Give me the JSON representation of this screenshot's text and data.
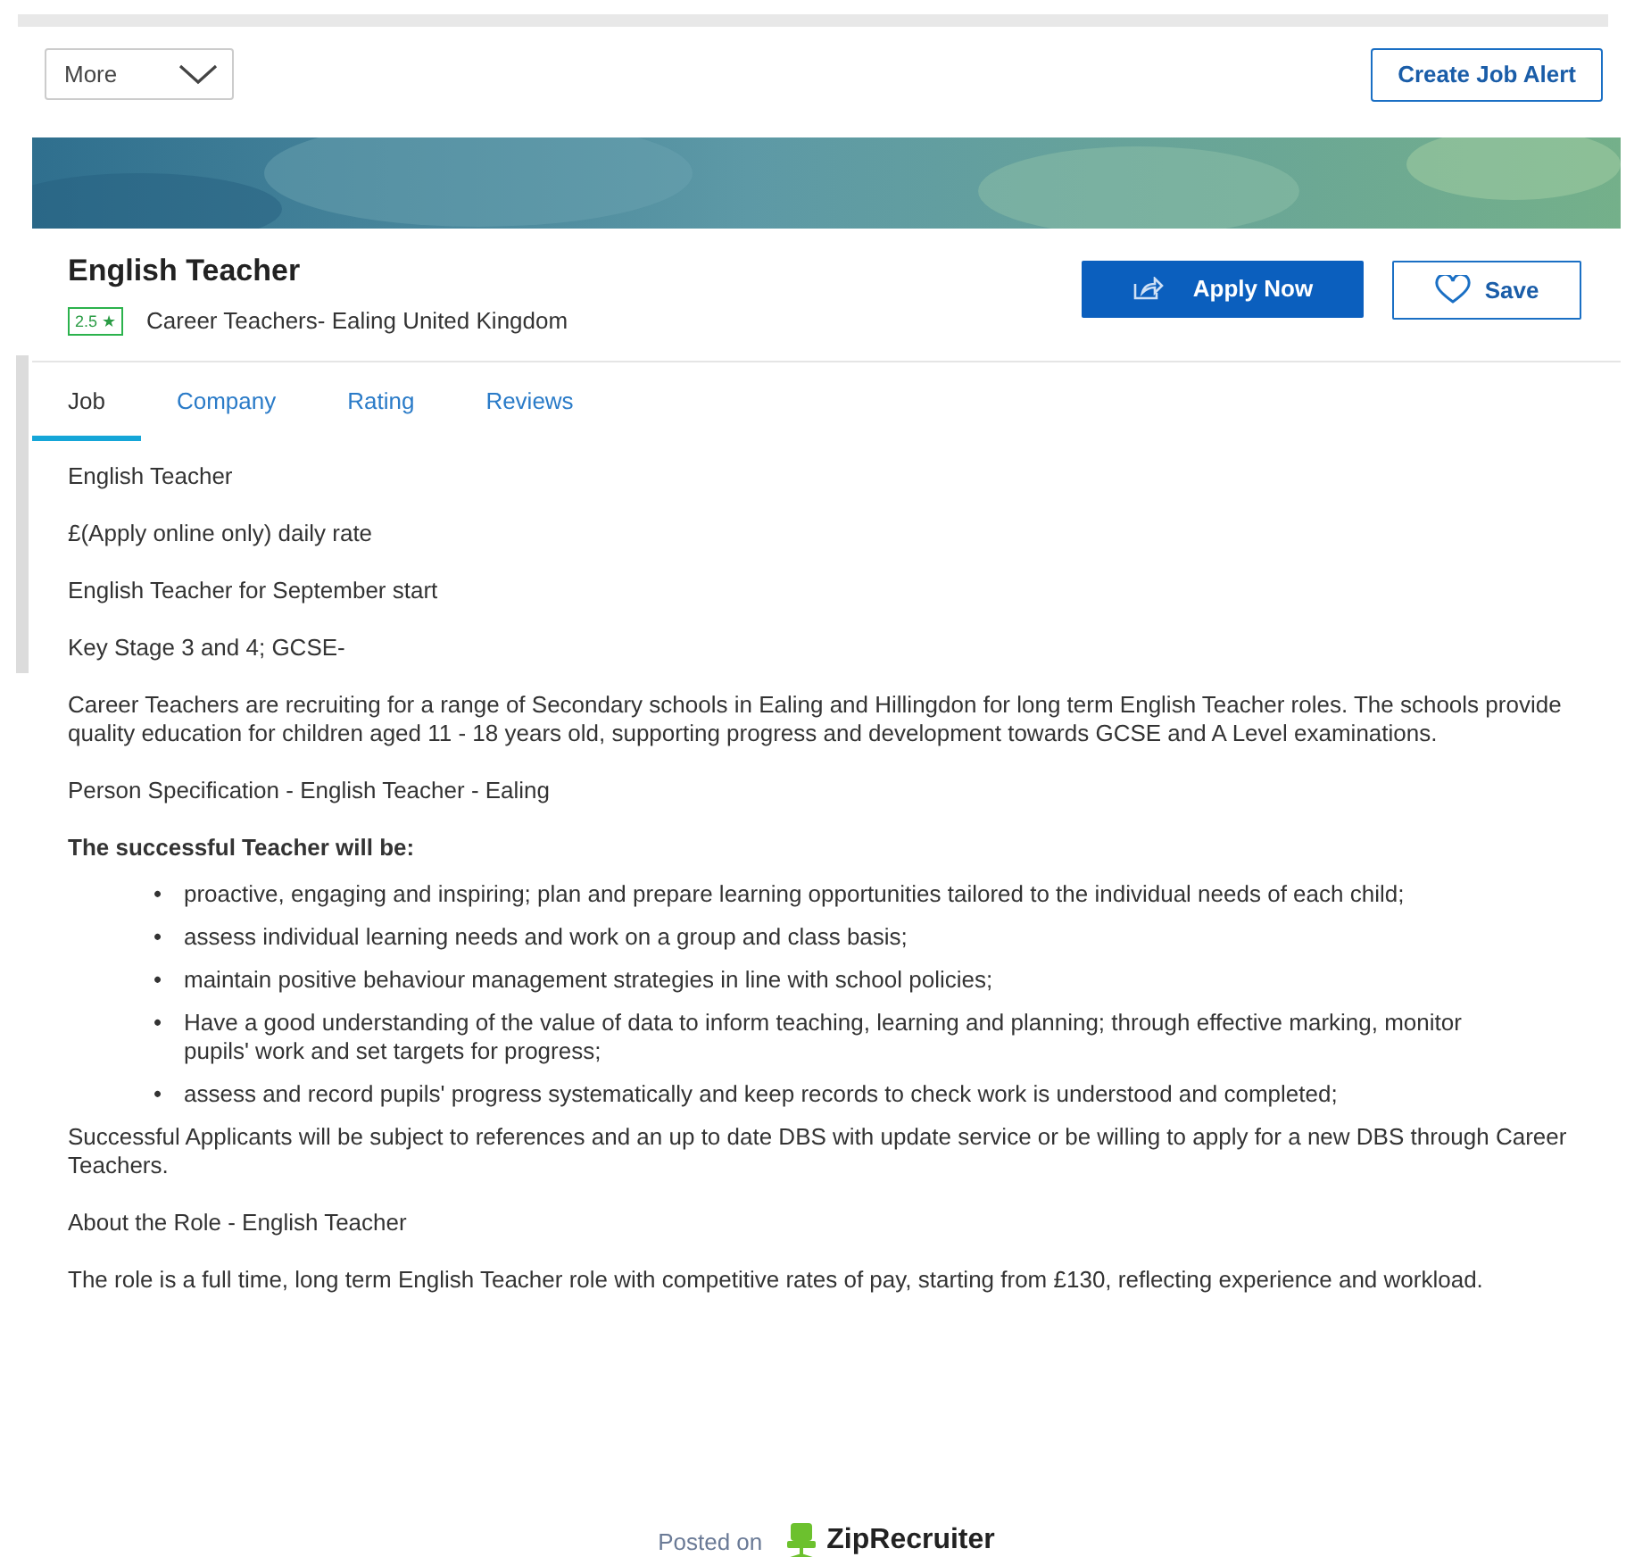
{
  "toolbar": {
    "more_label": "More",
    "alert_button": "Create Job Alert"
  },
  "job": {
    "title": "English Teacher",
    "rating": "2.5 ★",
    "company_location": "Career Teachers- Ealing United Kingdom",
    "apply_button": "Apply Now",
    "save_button": "Save"
  },
  "tabs": [
    {
      "label": "Job",
      "selected": true
    },
    {
      "label": "Company",
      "selected": false
    },
    {
      "label": "Rating",
      "selected": false
    },
    {
      "label": "Reviews",
      "selected": false
    }
  ],
  "description": [
    {
      "kind": "paragraph",
      "text": "English Teacher"
    },
    {
      "kind": "paragraph",
      "text": "£(Apply online only) daily rate"
    },
    {
      "kind": "paragraph",
      "text": "English Teacher for September start"
    },
    {
      "kind": "paragraph",
      "text": "Key Stage 3 and 4; GCSE-"
    },
    {
      "kind": "paragraph",
      "text": "Career Teachers are recruiting for a range of Secondary schools in Ealing and Hillingdon for long term English Teacher roles. The schools provide quality education for children aged 11 - 18 years old, supporting progress and development towards GCSE and A Level examinations."
    },
    {
      "kind": "paragraph",
      "text": "Person Specification - English Teacher - Ealing"
    },
    {
      "kind": "heading",
      "text": "The successful Teacher will be:"
    },
    {
      "kind": "bullets",
      "items": [
        {
          "marker": "•",
          "text": "proactive, engaging and inspiring; plan and prepare learning opportunities tailored to the individual needs of each child;"
        },
        {
          "marker": "•",
          "text": "assess individual learning needs and work on a group and class basis;"
        },
        {
          "marker": "•",
          "text": "maintain positive behaviour management strategies in line with school policies;"
        },
        {
          "marker": "•",
          "text": "Have a good understanding of the value of data to inform teaching, learning and planning; through effective marking, monitor pupils' work and set targets for progress;"
        },
        {
          "marker": "•",
          "text": "assess and record pupils' progress systematically and keep records to check work is understood and completed;"
        }
      ]
    },
    {
      "kind": "paragraph",
      "text": "Successful Applicants will be subject to references and an up to date DBS with update service or be willing to apply for a new DBS through Career Teachers."
    },
    {
      "kind": "paragraph",
      "text": "About the Role - English Teacher"
    },
    {
      "kind": "paragraph",
      "text": "The role is a full time, long term English Teacher role with competitive rates of pay, starting from £130, reflecting experience and workload."
    }
  ],
  "footer": {
    "posted_on": "Posted on",
    "brand": "ZipRecruiter"
  }
}
